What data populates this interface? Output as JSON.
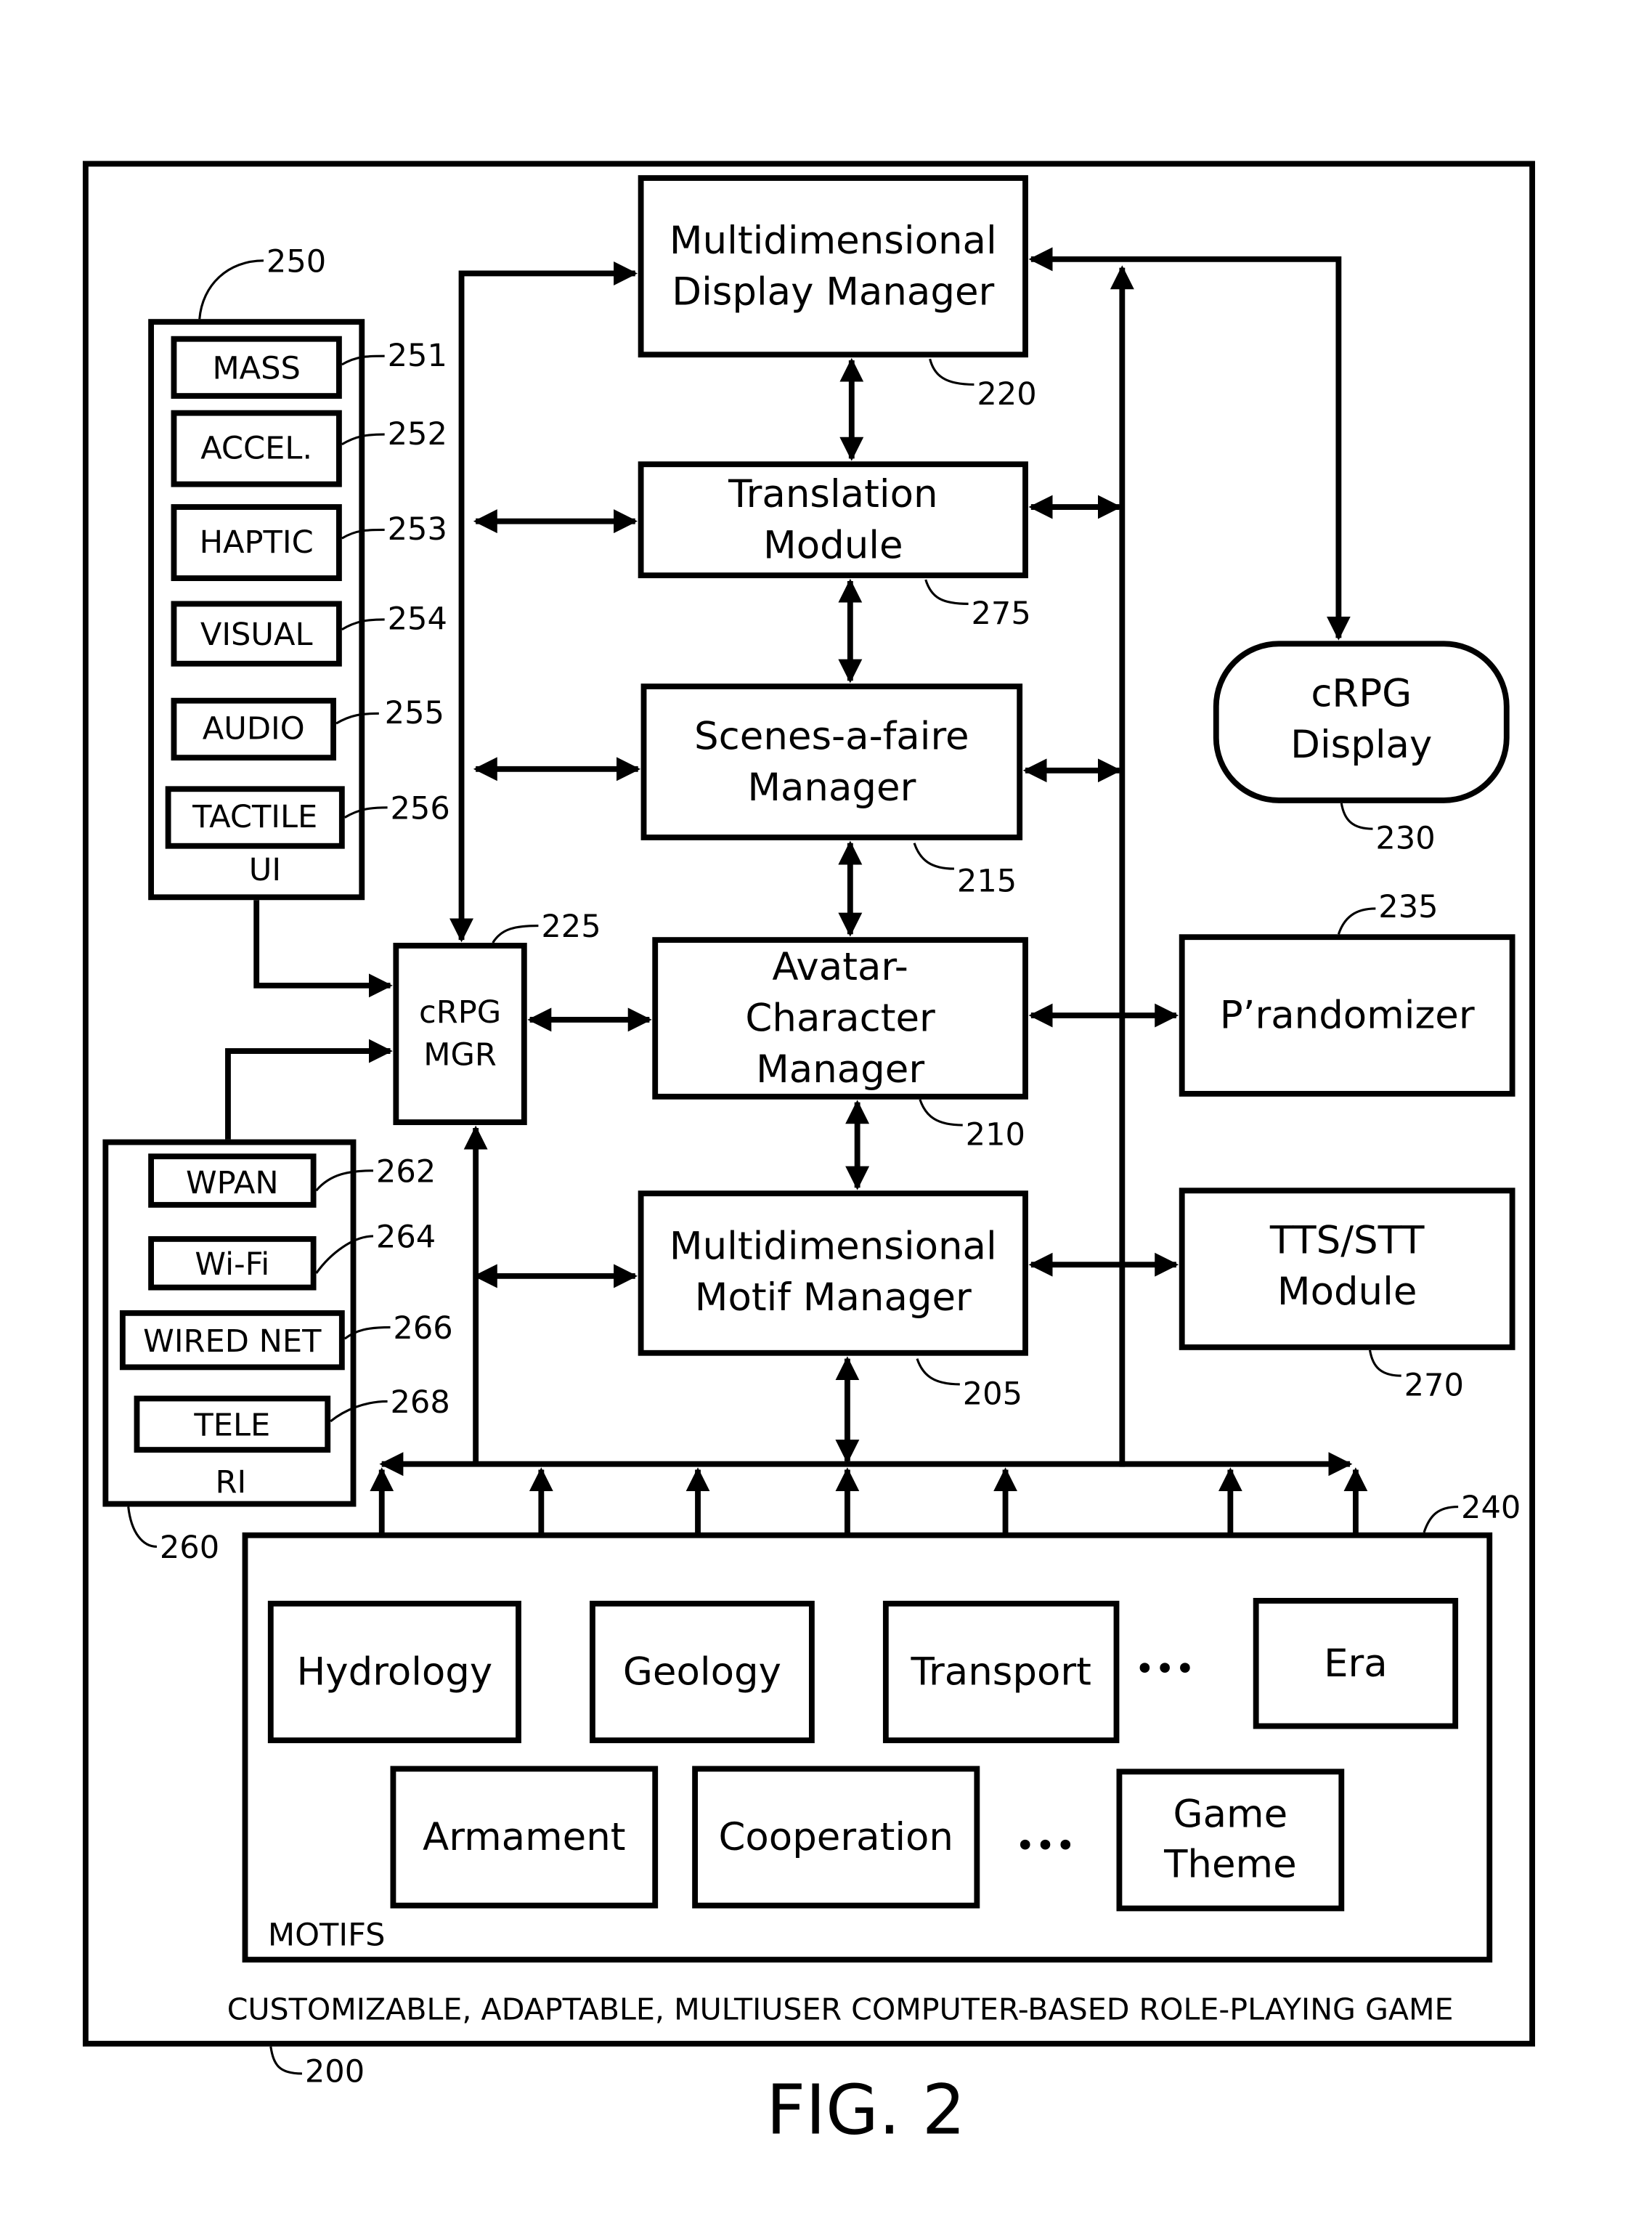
{
  "figure": {
    "caption": "FIG. 2",
    "system_title": "CUSTOMIZABLE, ADAPTABLE, MULTIUSER COMPUTER-BASED ROLE-PLAYING GAME",
    "system_ref": "200"
  },
  "modules": {
    "display_mgr": {
      "lines": [
        "Multidimensional",
        "Display Manager"
      ],
      "ref": "220"
    },
    "translation": {
      "lines": [
        "Translation",
        "Module"
      ],
      "ref": "275"
    },
    "scenes": {
      "lines": [
        "Scenes-a-faire",
        "Manager"
      ],
      "ref": "215"
    },
    "avatar": {
      "lines": [
        "Avatar-",
        "Character",
        "Manager"
      ],
      "ref": "210"
    },
    "motif_mgr": {
      "lines": [
        "Multidimensional",
        "Motif Manager"
      ],
      "ref": "205"
    },
    "crpg_display": {
      "lines": [
        "cRPG",
        "Display"
      ],
      "ref": "230"
    },
    "prandomizer": {
      "lines": [
        "P’randomizer"
      ],
      "ref": "235"
    },
    "tts": {
      "lines": [
        "TTS/STT",
        "Module"
      ],
      "ref": "270"
    },
    "crpg_mgr": {
      "lines": [
        "cRPG",
        "MGR"
      ],
      "ref": "225"
    }
  },
  "ui": {
    "label": "UI",
    "ref": "250",
    "items": [
      {
        "label": "MASS",
        "ref": "251"
      },
      {
        "label": "ACCEL.",
        "ref": "252"
      },
      {
        "label": "HAPTIC",
        "ref": "253"
      },
      {
        "label": "VISUAL",
        "ref": "254"
      },
      {
        "label": "AUDIO",
        "ref": "255"
      },
      {
        "label": "TACTILE",
        "ref": "256"
      }
    ]
  },
  "ri": {
    "label": "RI",
    "ref": "260",
    "items": [
      {
        "label": "WPAN",
        "ref": "262"
      },
      {
        "label": "Wi-Fi",
        "ref": "264"
      },
      {
        "label": "WIRED NET",
        "ref": "266"
      },
      {
        "label": "TELE",
        "ref": "268"
      }
    ]
  },
  "motifs": {
    "label": "MOTIFS",
    "ref": "240",
    "row1": [
      "Hydrology",
      "Geology",
      "Transport",
      "Era"
    ],
    "row2": [
      "Armament",
      "Cooperation",
      "Game",
      "Theme"
    ],
    "ellipsis": "•••"
  }
}
